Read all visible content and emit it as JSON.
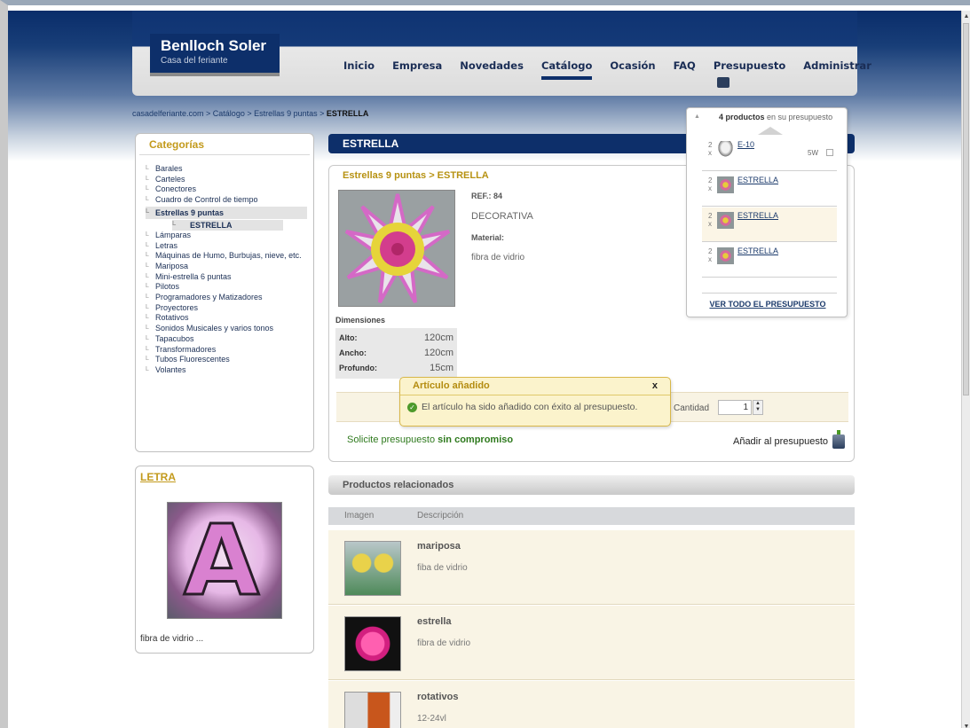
{
  "header": {
    "brand_name": "Benlloch Soler",
    "brand_tagline": "Casa del feriante",
    "nav": [
      "Inicio",
      "Empresa",
      "Novedades",
      "Catálogo",
      "Ocasión",
      "FAQ",
      "Presupuesto",
      "Administrar"
    ],
    "nav_active": "Catálogo"
  },
  "breadcrumb": {
    "path": "casadelferiante.com > Catálogo > Estrellas 9 puntas > ",
    "current": "ESTRELLA"
  },
  "sidebar": {
    "categories_title": "Categorías",
    "categories": [
      "Barales",
      "Carteles",
      "Conectores",
      "Cuadro de Control de tiempo",
      "Estrellas 9 puntas",
      "ESTRELLA",
      "Lámparas",
      "Letras",
      "Máquinas de Humo, Burbujas, nieve, etc.",
      "Mariposa",
      "Mini-estrella 6 puntas",
      "Pilotos",
      "Programadores y Matizadores",
      "Proyectores",
      "Rotativos",
      "Sonidos Musicales y varios tonos",
      "Tapacubos",
      "Transformadores",
      "Tubos Fluorescentes",
      "Volantes"
    ],
    "featured_title": "LETRA",
    "featured_caption": "fibra de vidrio ..."
  },
  "product": {
    "page_title": "ESTRELLA",
    "subtitle": "Estrellas 9 puntas > ESTRELLA",
    "ref": "REF.: 84",
    "type": "DECORATIVA",
    "material_label": "Material:",
    "material": "fibra de vidrio",
    "dimensions_title": "Dimensiones",
    "dimensions": [
      {
        "label": "Alto:",
        "value": "120cm"
      },
      {
        "label": "Ancho:",
        "value": "120cm"
      },
      {
        "label": "Profundo:",
        "value": "15cm"
      }
    ],
    "quantity_label": "Cantidad",
    "quantity_value": "1",
    "solicite_prefix": "Solicite presupuesto ",
    "solicite_bold": "sin compromiso",
    "add_button": "Añadir al presupuesto"
  },
  "toast": {
    "title": "Artículo añadido",
    "close": "x",
    "message": "El artículo ha sido añadido con éxito al presupuesto."
  },
  "budget_panel": {
    "count_bold": "4 productos",
    "count_rest": " en su presupuesto",
    "items": [
      {
        "qty": "2",
        "x": "x",
        "name": "E-10",
        "watt": "5W"
      },
      {
        "qty": "2",
        "x": "x",
        "name": "ESTRELLA"
      },
      {
        "qty": "2",
        "x": "x",
        "name": "ESTRELLA"
      },
      {
        "qty": "2",
        "x": "x",
        "name": "ESTRELLA"
      }
    ],
    "view_all": "VER TODO EL PRESUPUESTO"
  },
  "related": {
    "title": "Productos relacionados",
    "col_image": "Imagen",
    "col_desc": "Descripción",
    "items": [
      {
        "name": "mariposa",
        "desc": "fiba de vidrio"
      },
      {
        "name": "estrella",
        "desc": "fibra de vidrio"
      },
      {
        "name": "rotativos",
        "desc": "12-24vl"
      }
    ]
  }
}
